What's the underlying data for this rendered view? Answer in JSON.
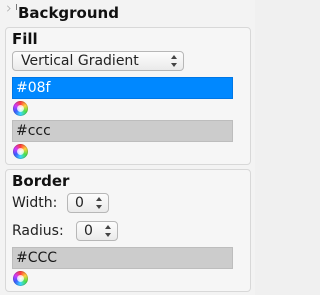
{
  "panel": {
    "title": "Background"
  },
  "fill": {
    "title": "Fill",
    "gradient_type": "Vertical Gradient",
    "color1": "#08f",
    "color2": "#ccc"
  },
  "border": {
    "title": "Border",
    "width_label": "Width:",
    "width_value": "0",
    "radius_label": "Radius:",
    "radius_value": "0",
    "color": "#CCC"
  },
  "icons": {
    "collapse": "collapse-arrow-icon",
    "color_picker": "color-wheel-icon",
    "spinner": "up-down-arrows-icon"
  },
  "colors": {
    "selected_swatch": "#0088ff",
    "gray_swatch": "#cccccc"
  }
}
